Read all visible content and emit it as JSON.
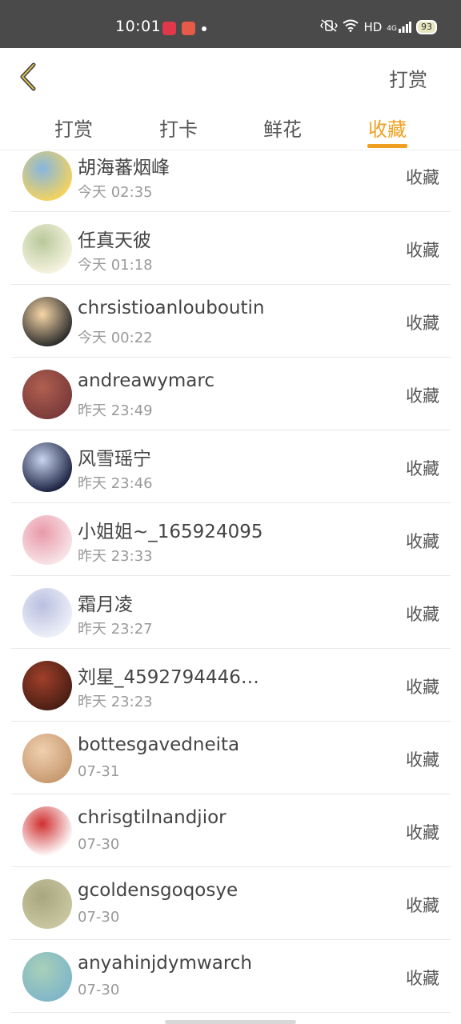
{
  "status_bar": {
    "time": "10:01",
    "network": "HD",
    "signal": "4G",
    "battery": "93"
  },
  "header": {
    "right_action": "打赏"
  },
  "tabs": [
    {
      "label": "打赏",
      "active": false
    },
    {
      "label": "打卡",
      "active": false
    },
    {
      "label": "鲜花",
      "active": false
    },
    {
      "label": "收藏",
      "active": true
    }
  ],
  "accent_color": "#f0a020",
  "entries": [
    {
      "name": "胡海蕃烟峰",
      "time": "今天 02:35",
      "action": "收藏",
      "avatar_colors": [
        "#f4d35e",
        "#86b6e0"
      ]
    },
    {
      "name": "任真天彼",
      "time": "今天 01:18",
      "action": "收藏",
      "avatar_colors": [
        "#f6f3e0",
        "#b8c99a"
      ]
    },
    {
      "name": "chrsistioanlouboutin",
      "time": "今天 00:22",
      "action": "收藏",
      "avatar_colors": [
        "#2b2b2b",
        "#f8d7a8"
      ]
    },
    {
      "name": "andreawymarc",
      "time": "昨天 23:49",
      "action": "收藏",
      "avatar_colors": [
        "#7a3a3a",
        "#b06050"
      ]
    },
    {
      "name": "风雪瑶宁",
      "time": "昨天 23:46",
      "action": "收藏",
      "avatar_colors": [
        "#1a2240",
        "#c8d4f0"
      ]
    },
    {
      "name": "小姐姐~_165924095",
      "time": "昨天 23:33",
      "action": "收藏",
      "avatar_colors": [
        "#f8e4e8",
        "#e89aa8"
      ]
    },
    {
      "name": "霜月凌",
      "time": "昨天 23:27",
      "action": "收藏",
      "avatar_colors": [
        "#eef0f8",
        "#b9bfe0"
      ]
    },
    {
      "name": "刘星_45927944466...",
      "time": "昨天 23:23",
      "action": "收藏",
      "avatar_colors": [
        "#4a1e14",
        "#a0402a"
      ]
    },
    {
      "name": "bottesgavedneita",
      "time": "07-31",
      "action": "收藏",
      "avatar_colors": [
        "#c79a70",
        "#f0d0b0"
      ]
    },
    {
      "name": "chrisgtilnandjior",
      "time": "07-30",
      "action": "收藏",
      "avatar_colors": [
        "#ffffff",
        "#d03030"
      ]
    },
    {
      "name": "gcoldensgoqosye",
      "time": "07-30",
      "action": "收藏",
      "avatar_colors": [
        "#c9c7a0",
        "#a8a67e"
      ]
    },
    {
      "name": "anyahinjdymwarch",
      "time": "07-30",
      "action": "收藏",
      "avatar_colors": [
        "#7fb6c8",
        "#a8d0b8"
      ]
    }
  ]
}
